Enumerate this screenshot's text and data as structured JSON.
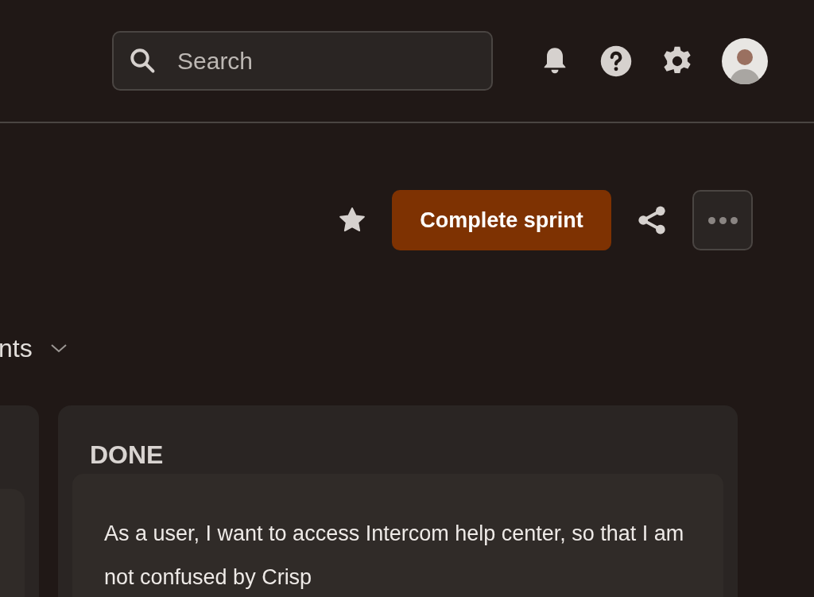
{
  "search": {
    "placeholder": "Search"
  },
  "sprint_actions": {
    "primary_button": "Complete sprint"
  },
  "filter": {
    "label": "nts"
  },
  "columns": [
    {
      "title": "DONE",
      "cards": [
        {
          "text": "As a user, I want to access Intercom help center, so that I am not confused by Crisp"
        }
      ]
    }
  ]
}
